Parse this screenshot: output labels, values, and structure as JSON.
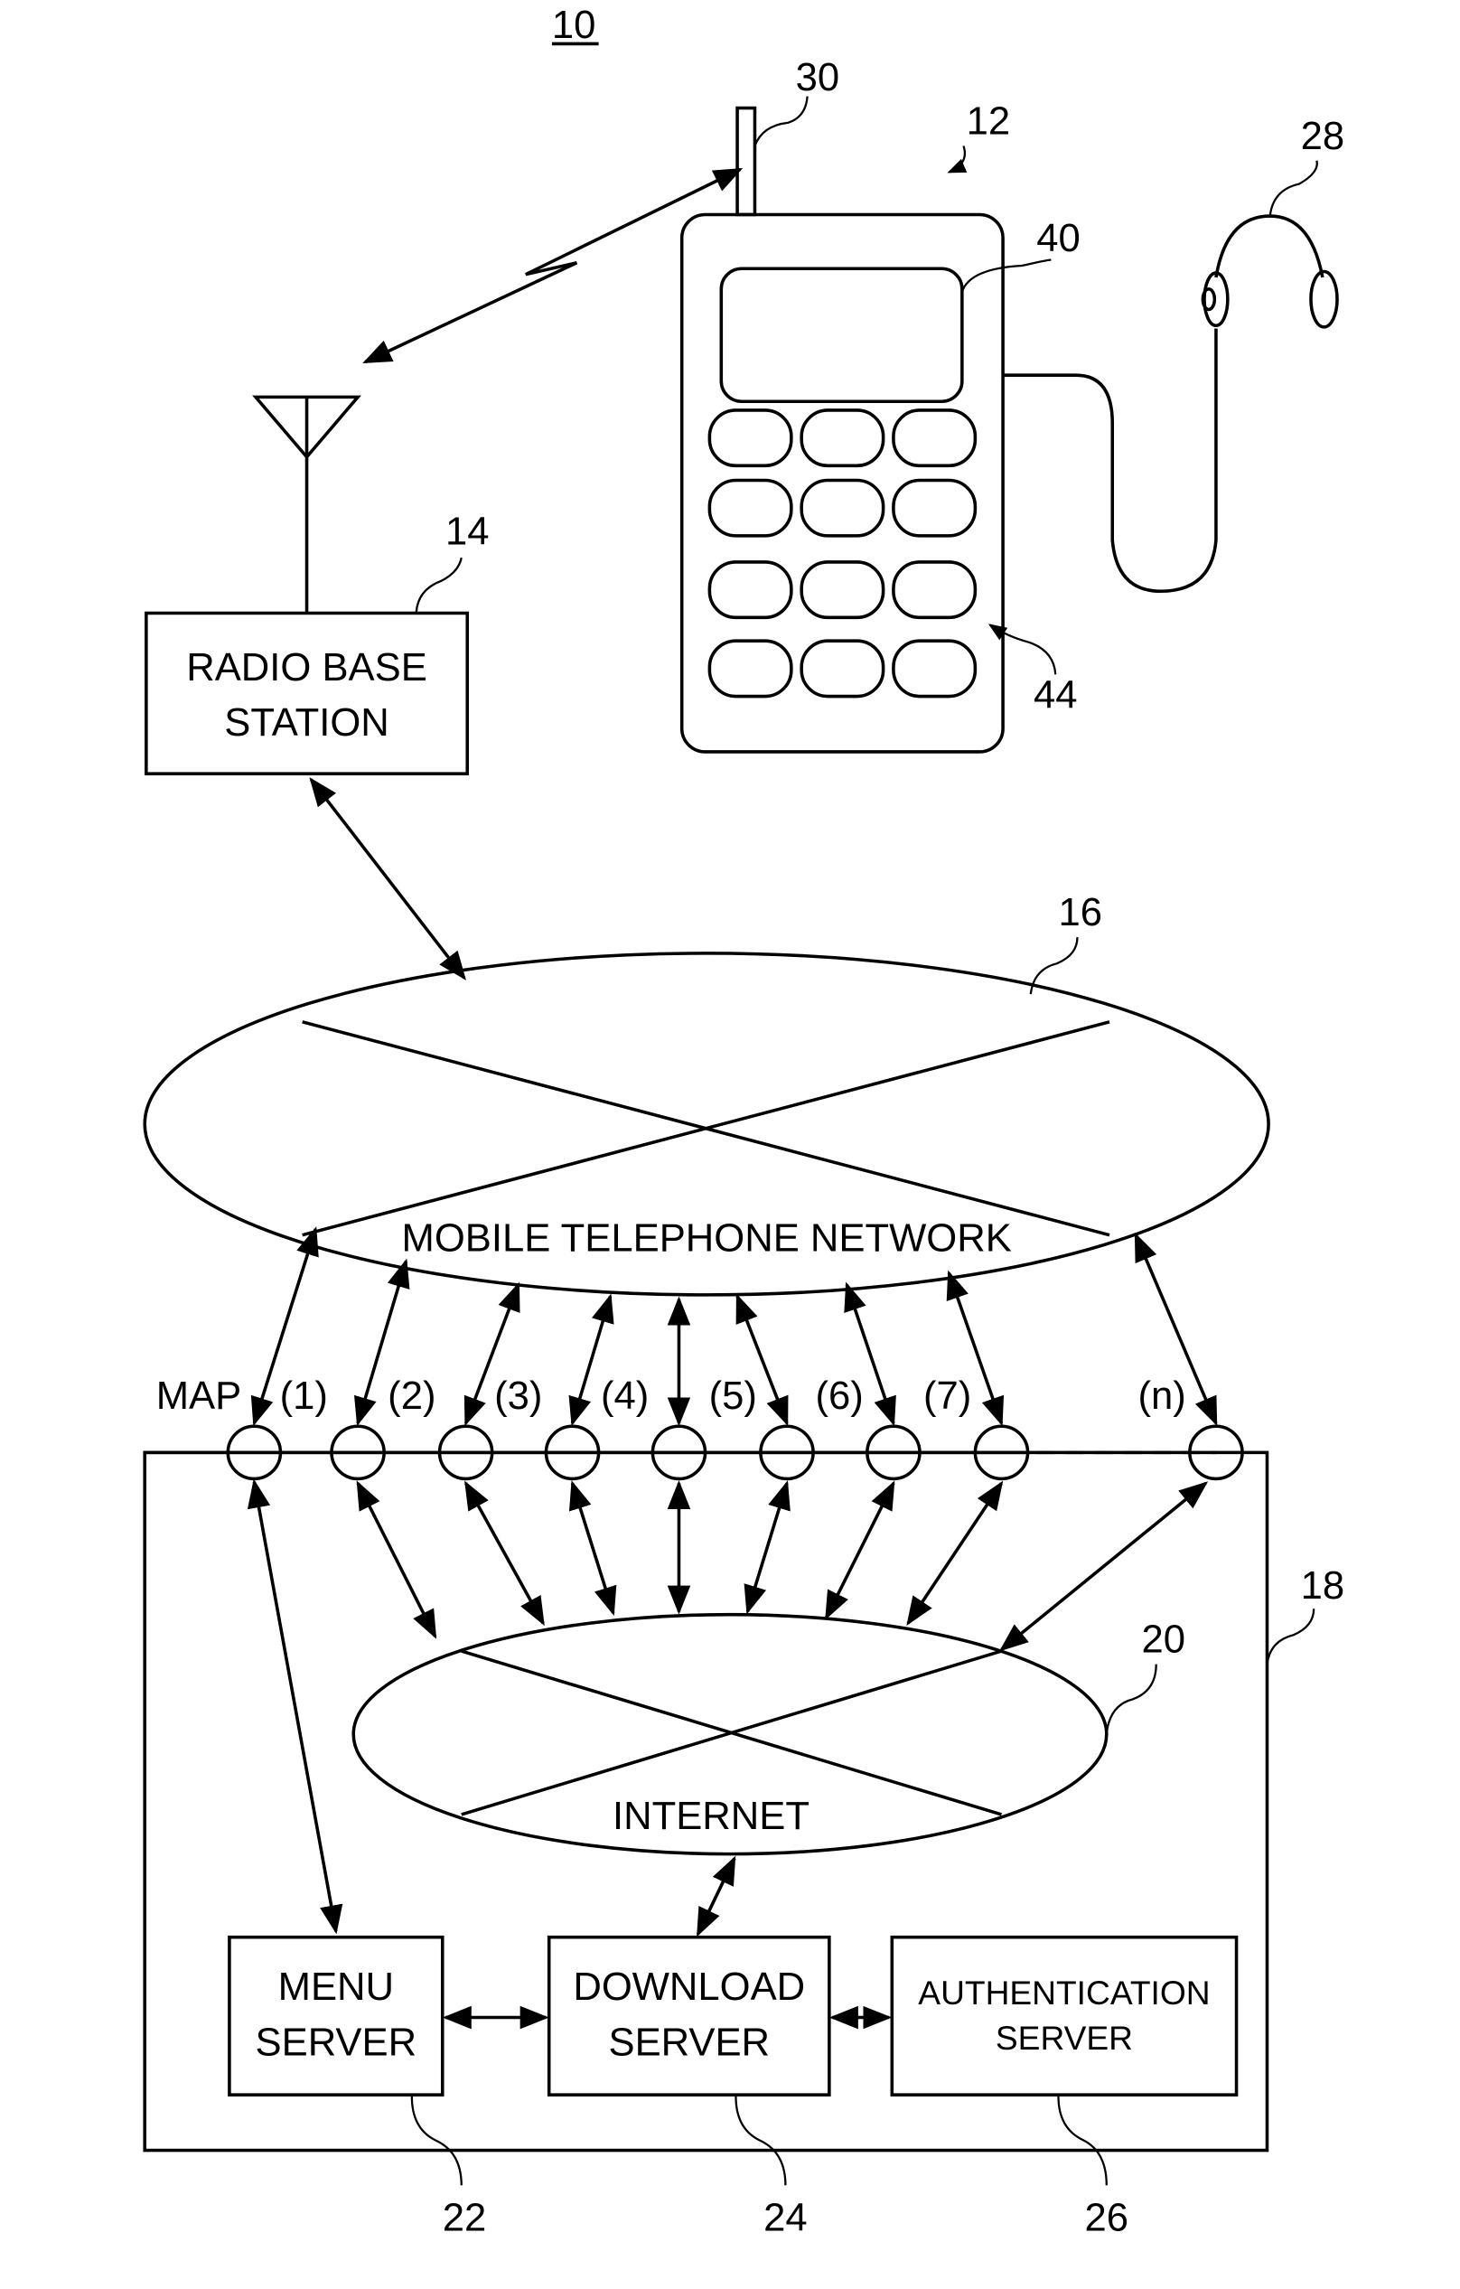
{
  "figure": {
    "number_label": "10",
    "ref_phone": "12",
    "ref_antenna": "30",
    "ref_display": "40",
    "ref_keypad": "44",
    "ref_headset": "28",
    "ref_base_station": "14",
    "ref_mobile_network": "16",
    "ref_server_system": "18",
    "ref_internet": "20",
    "ref_menu_server": "22",
    "ref_download_server": "24",
    "ref_auth_server": "26"
  },
  "nodes": {
    "radio_base_station": [
      "RADIO BASE",
      "STATION"
    ],
    "mobile_network": "MOBILE TELEPHONE NETWORK",
    "internet": "INTERNET",
    "menu_server": [
      "MENU",
      "SERVER"
    ],
    "download_server": [
      "DOWNLOAD",
      "SERVER"
    ],
    "auth_server": [
      "AUTHENTICATION",
      "SERVER"
    ]
  },
  "gateways": [
    "MAP",
    "(1)",
    "(2)",
    "(3)",
    "(4)",
    "(5)",
    "(6)",
    "(7)",
    "(n)"
  ]
}
